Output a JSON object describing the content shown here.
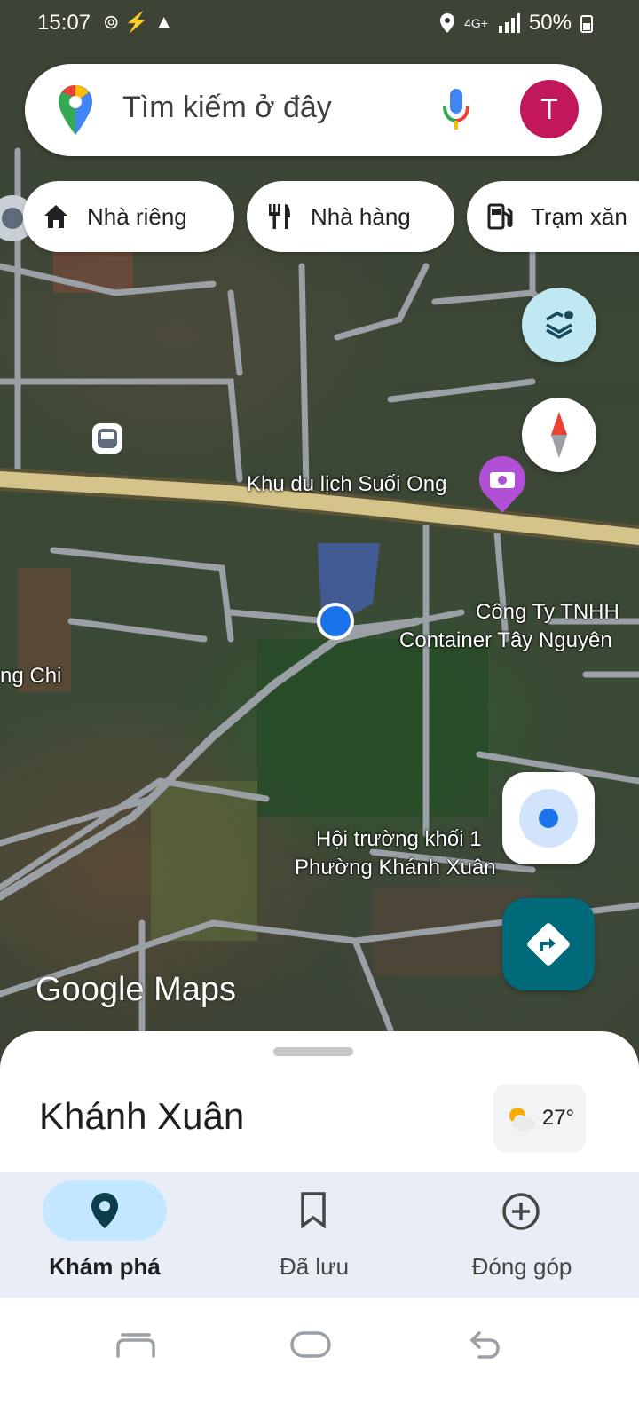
{
  "status_bar": {
    "time": "15:07",
    "left_icons": "⊚⚡▲",
    "network": "4G+",
    "battery": "50%"
  },
  "search": {
    "placeholder": "Tìm kiếm ở đây",
    "avatar_letter": "T"
  },
  "chips": [
    {
      "label": "Nhà riêng",
      "icon": "home-icon"
    },
    {
      "label": "Nhà hàng",
      "icon": "restaurant-icon"
    },
    {
      "label": "Trạm xăn",
      "icon": "gas-station-icon"
    }
  ],
  "map_labels": {
    "poi": "Khu du lịch Suối Ong",
    "company_1": "Công Ty TNHH",
    "company_2": "Container Tây Nguyên",
    "partial_left": "ng Chi",
    "hall_1": "Hội trường khối 1",
    "hall_2": "Phường Khánh Xuân"
  },
  "logo": "Google Maps",
  "sheet": {
    "title": "Khánh Xuân",
    "temperature": "27°"
  },
  "bottom_nav": [
    {
      "label": "Khám phá",
      "icon": "explore-pin-icon",
      "active": true
    },
    {
      "label": "Đã lưu",
      "icon": "bookmark-icon",
      "active": false
    },
    {
      "label": "Đóng góp",
      "icon": "add-circle-icon",
      "active": false
    }
  ],
  "colors": {
    "accent": "#006a7a",
    "pill": "#c2e7ff",
    "avatar": "#c2185b",
    "location_dot": "#1a73e8"
  }
}
